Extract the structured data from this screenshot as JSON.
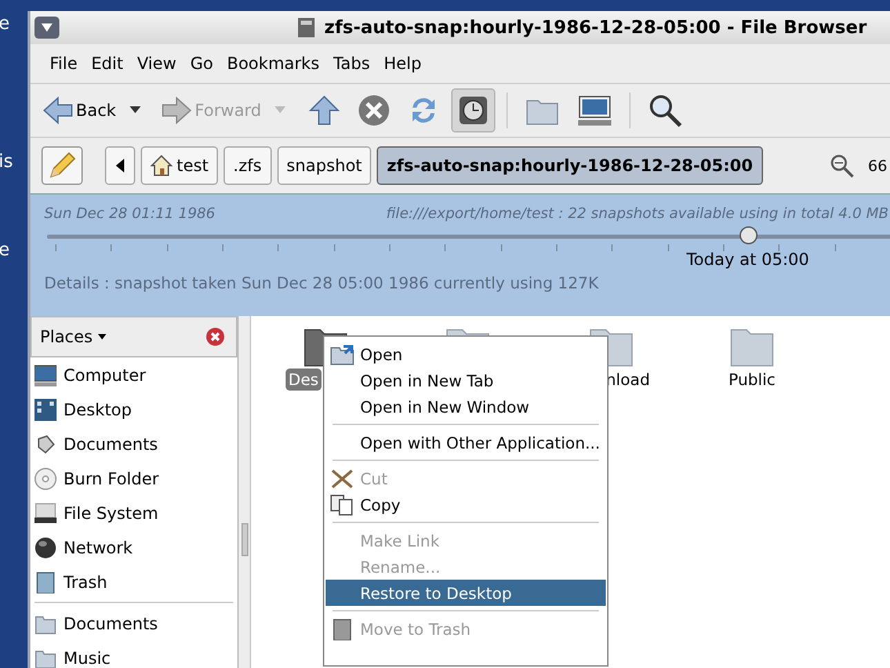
{
  "desktop": {
    "labels": [
      "e",
      "is",
      "e"
    ]
  },
  "window": {
    "title": "zfs-auto-snap:hourly-1986-12-28-05:00 - File Browser"
  },
  "menu_bar": [
    "File",
    "Edit",
    "View",
    "Go",
    "Bookmarks",
    "Tabs",
    "Help"
  ],
  "toolbar": {
    "back": {
      "label": "Back",
      "disabled": false
    },
    "forward": {
      "label": "Forward",
      "disabled": true
    },
    "snapshot_toggle": {
      "on": true
    }
  },
  "location_bar": {
    "crumbs": [
      {
        "label": "test",
        "kind": "home",
        "selected": false
      },
      {
        "label": ".zfs",
        "kind": "plain",
        "selected": false
      },
      {
        "label": "snapshot",
        "kind": "plain",
        "selected": false
      },
      {
        "label": "zfs-auto-snap:hourly-1986-12-28-05:00",
        "kind": "plain",
        "selected": true
      }
    ],
    "zoom": "66"
  },
  "time_slider": {
    "start_date": "Sun Dec 28 01:11 1986",
    "summary": "file:///export/home/test : 22 snapshots available using in total 4.0 MB",
    "level": 0.83,
    "position_label": "Today at 05:00",
    "details": "Details : snapshot taken Sun Dec 28 05:00 1986 currently using 127K"
  },
  "sidebar": {
    "title": "Places",
    "items": [
      {
        "label": "Computer",
        "kind": "computer"
      },
      {
        "label": "Desktop",
        "kind": "desktop"
      },
      {
        "label": "Documents",
        "kind": "documents"
      },
      {
        "label": "Burn Folder",
        "kind": "disc"
      },
      {
        "label": "File System",
        "kind": "drive"
      },
      {
        "label": "Network",
        "kind": "network"
      },
      {
        "label": "Trash",
        "kind": "trash"
      },
      {
        "label": "Documents",
        "kind": "folder"
      },
      {
        "label": "Music",
        "kind": "folder"
      }
    ]
  },
  "files": [
    {
      "label": "Des",
      "selected": true
    },
    {
      "selected": false
    },
    {
      "label": "nload",
      "selected": false
    },
    {
      "label": "Public",
      "selected": false
    }
  ],
  "context_menu": [
    {
      "kind": "open",
      "label": "Open",
      "disabled": false,
      "selected": false
    },
    {
      "kind": "item",
      "label": "Open in New Tab",
      "disabled": false,
      "selected": false
    },
    {
      "kind": "item",
      "label": "Open in New Window",
      "disabled": false,
      "selected": false
    },
    {
      "kind": "separator"
    },
    {
      "kind": "item",
      "label": "Open with Other Application...",
      "disabled": false,
      "selected": false
    },
    {
      "kind": "separator"
    },
    {
      "kind": "cut",
      "label": "Cut",
      "disabled": true,
      "selected": false
    },
    {
      "kind": "copy",
      "label": "Copy",
      "disabled": false,
      "selected": false
    },
    {
      "kind": "separator"
    },
    {
      "kind": "item",
      "label": "Make Link",
      "disabled": true,
      "selected": false
    },
    {
      "kind": "item",
      "label": "Rename...",
      "disabled": true,
      "selected": false
    },
    {
      "kind": "item",
      "label": "Restore to Desktop",
      "disabled": false,
      "selected": true
    },
    {
      "kind": "separator"
    },
    {
      "kind": "trash",
      "label": "Move to Trash",
      "disabled": true,
      "selected": false
    }
  ]
}
